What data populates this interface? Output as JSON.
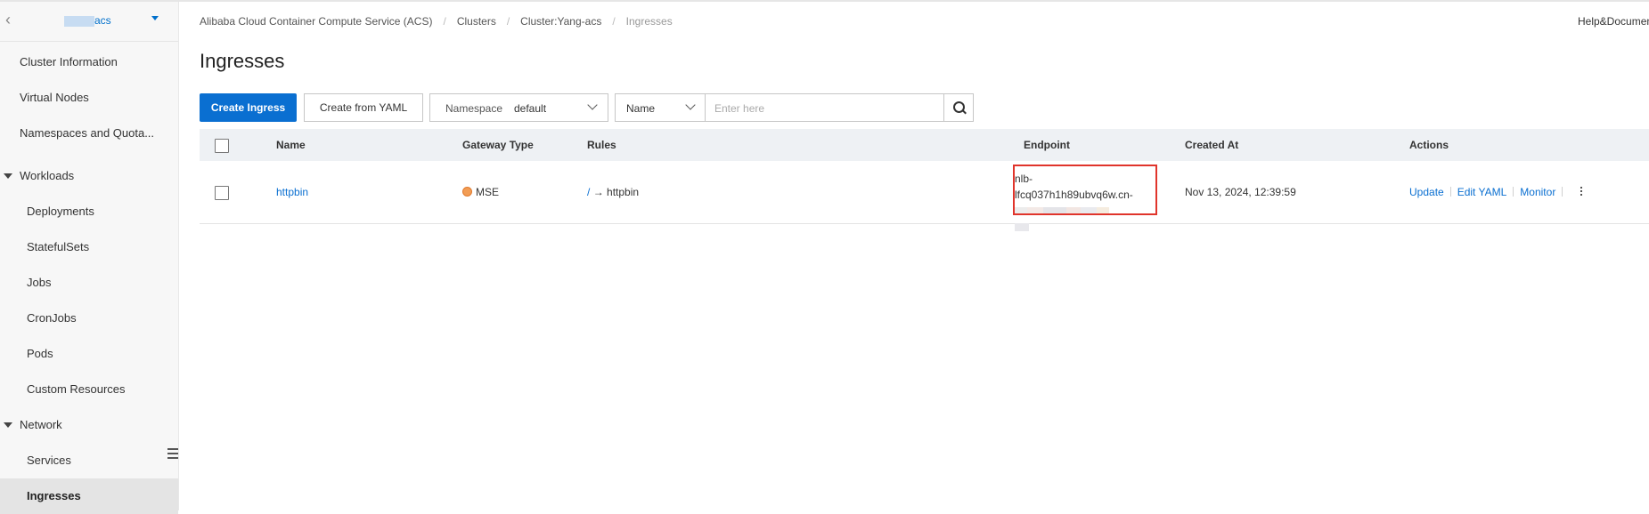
{
  "sidebar": {
    "cluster_name_suffix": "acs",
    "items": [
      {
        "label": "Cluster Information"
      },
      {
        "label": "Virtual Nodes"
      },
      {
        "label": "Namespaces and Quota..."
      },
      {
        "label": "Workloads"
      },
      {
        "label": "Deployments"
      },
      {
        "label": "StatefulSets"
      },
      {
        "label": "Jobs"
      },
      {
        "label": "CronJobs"
      },
      {
        "label": "Pods"
      },
      {
        "label": "Custom Resources"
      },
      {
        "label": "Network"
      },
      {
        "label": "Services"
      },
      {
        "label": "Ingresses"
      }
    ]
  },
  "breadcrumb": {
    "items": [
      "Alibaba Cloud Container Compute Service (ACS)",
      "Clusters",
      "Cluster:Yang-acs",
      "Ingresses"
    ],
    "separator": "/"
  },
  "header": {
    "help_label": "Help&Documentation"
  },
  "page": {
    "title": "Ingresses"
  },
  "toolbar": {
    "create_label": "Create Ingress",
    "create_yaml_label": "Create from YAML",
    "namespace_label": "Namespace",
    "namespace_value": "default",
    "search_field_value": "Name",
    "search_placeholder": "Enter here"
  },
  "table": {
    "columns": [
      "Name",
      "Gateway Type",
      "Rules",
      "Endpoint",
      "Created At",
      "Actions"
    ],
    "rows": [
      {
        "name": "httpbin",
        "gateway_type": "MSE",
        "rule_path": "/",
        "rule_arrow": "→",
        "rule_service": "httpbin",
        "endpoint_line1": "nlb-",
        "endpoint_line2": "lfcq037h1h89ubvq6w.cn-",
        "created_at": "Nov 13, 2024, 12:39:59",
        "actions": [
          "Update",
          "Edit YAML",
          "Monitor"
        ]
      }
    ]
  },
  "colors": {
    "primary": "#0a6fd1",
    "highlight_box": "#e0342b",
    "header_bg": "#eef1f4",
    "sidebar_bg": "#f7f7f7",
    "mse_icon": "#f29d55"
  }
}
